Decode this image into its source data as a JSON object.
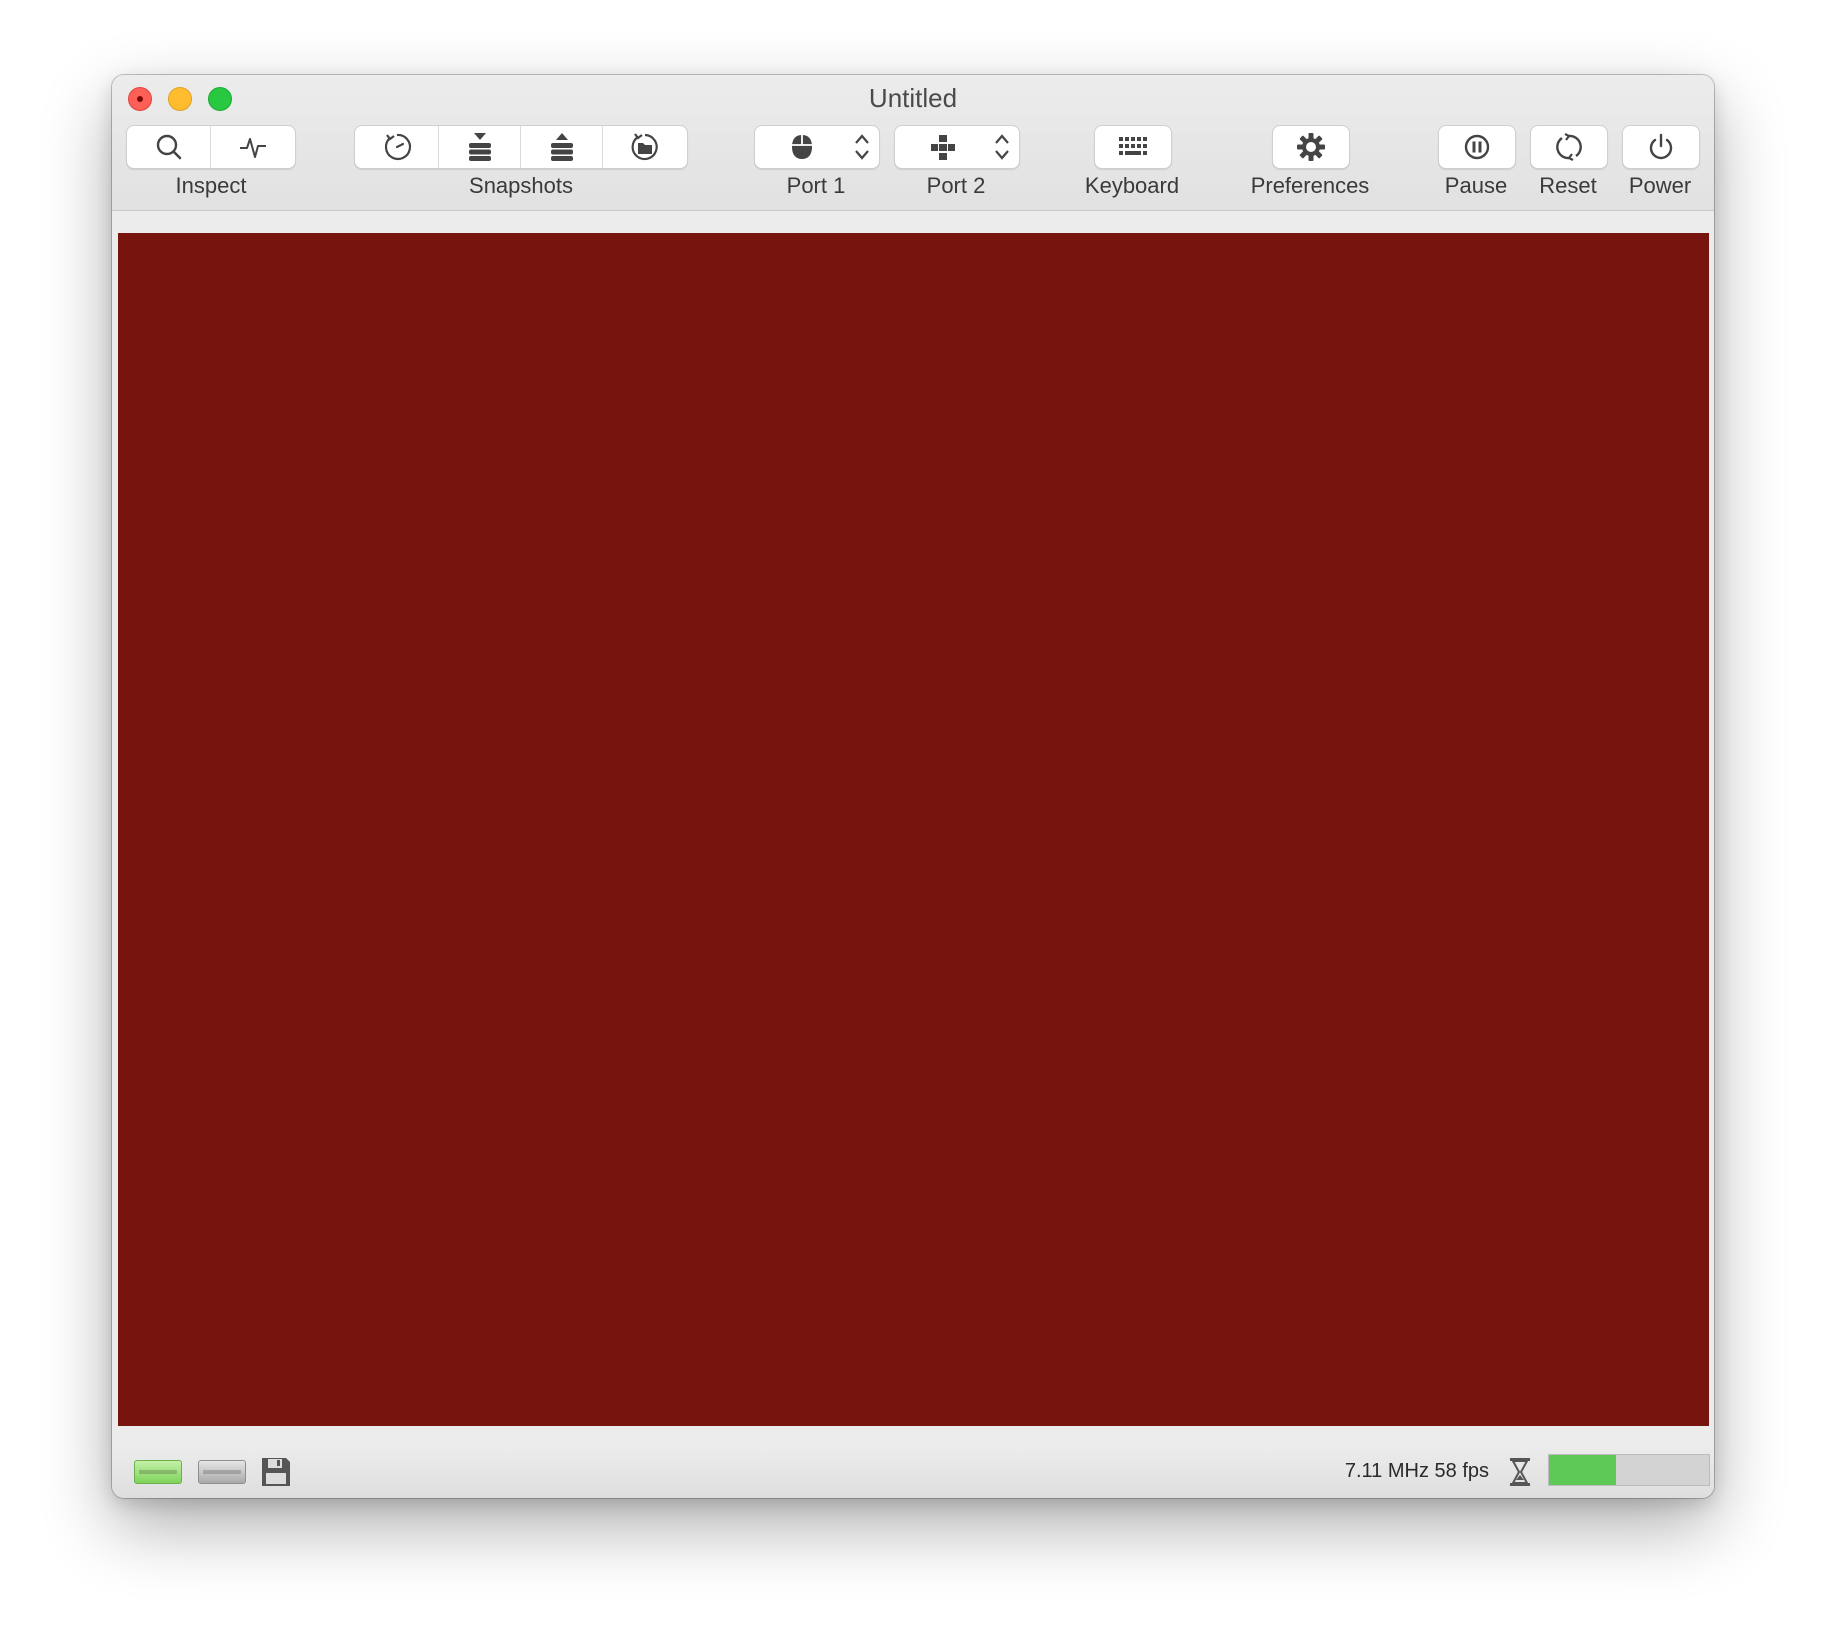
{
  "window": {
    "title": "Untitled"
  },
  "toolbar": {
    "inspect": {
      "label": "Inspect",
      "icons": [
        "search-icon",
        "activity-pulse-icon"
      ]
    },
    "snapshots": {
      "label": "Snapshots",
      "icons": [
        "revert-clock-icon",
        "take-snapshot-icon",
        "restore-snapshot-icon",
        "browse-snapshots-icon"
      ]
    },
    "port1": {
      "label": "Port 1",
      "icon": "mouse-icon"
    },
    "port2": {
      "label": "Port 2",
      "icon": "joystick-dpad-icon"
    },
    "keyboard": {
      "label": "Keyboard",
      "icon": "keyboard-icon"
    },
    "preferences": {
      "label": "Preferences",
      "icon": "gear-icon"
    },
    "pause": {
      "label": "Pause",
      "icon": "pause-icon"
    },
    "reset": {
      "label": "Reset",
      "icon": "reset-icon"
    },
    "power": {
      "label": "Power",
      "icon": "power-icon"
    }
  },
  "emulator_screen": {
    "color": "#76140d"
  },
  "statusbar": {
    "stats": "7.11 MHz 58 fps",
    "drive1_color": "#7ed35b",
    "drive2_color": "#a9a9a9",
    "performance_fraction": 0.42,
    "performance_color": "#5ec956"
  }
}
